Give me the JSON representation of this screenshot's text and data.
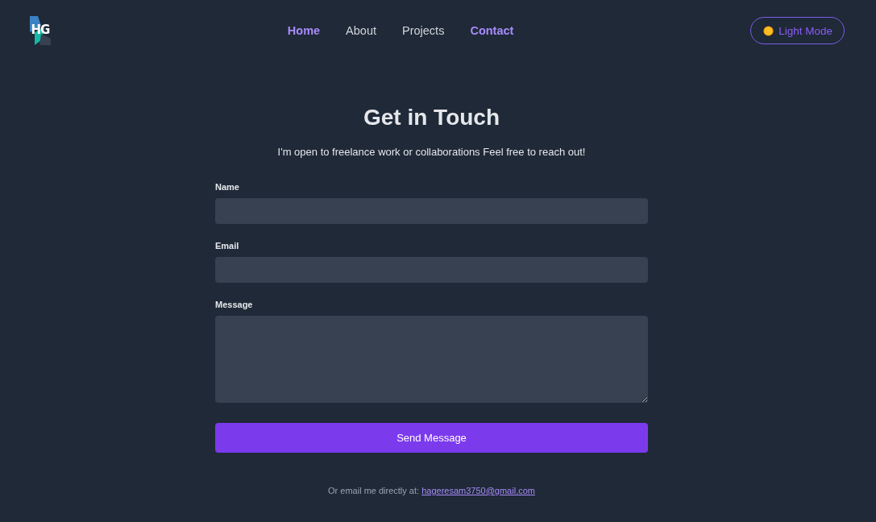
{
  "header": {
    "logo": "HG",
    "nav": [
      {
        "label": "Home",
        "selected": true
      },
      {
        "label": "About",
        "selected": false
      },
      {
        "label": "Projects",
        "selected": false
      },
      {
        "label": "Contact",
        "selected": true
      }
    ],
    "theme_button": {
      "label": "Light Mode"
    }
  },
  "contact": {
    "title": "Get in Touch",
    "subtitle": "I'm open to freelance work or collaborations Feel free to reach out!",
    "fields": [
      {
        "label": "Name",
        "kind": "input"
      },
      {
        "label": "Email",
        "kind": "input"
      },
      {
        "label": "Message",
        "kind": "textarea"
      }
    ],
    "submit": "Send Message",
    "footer": {
      "text": "Or email me directly at:",
      "link": "hageresam3750@gmail.com"
    }
  }
}
